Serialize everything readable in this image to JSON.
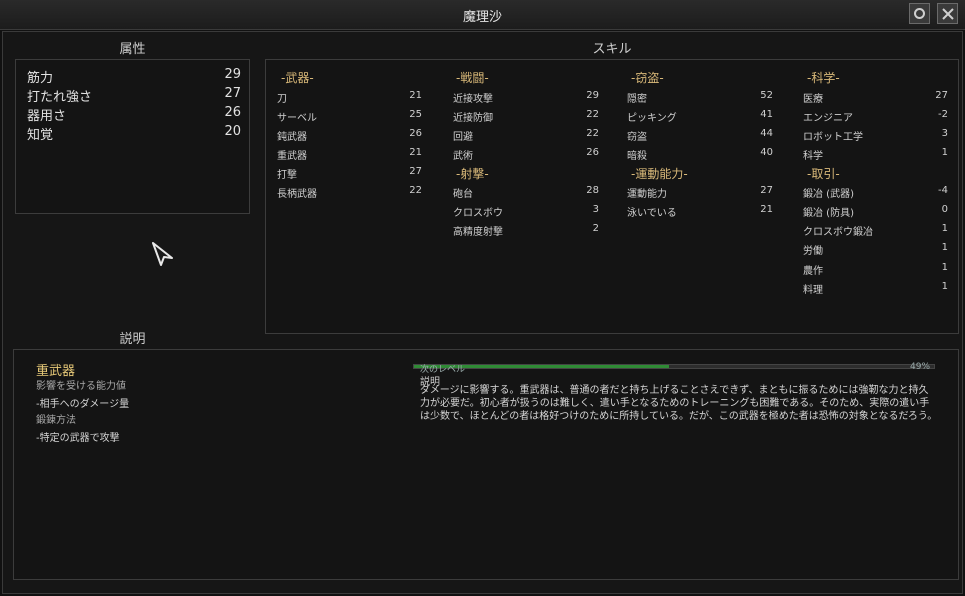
{
  "window": {
    "title": "魔理沙",
    "settings_icon": "gear-icon",
    "close_icon": "close-icon"
  },
  "attributes": {
    "header": "属性",
    "items": [
      {
        "name": "筋力",
        "value": "29"
      },
      {
        "name": "打たれ強さ",
        "value": "27"
      },
      {
        "name": "器用さ",
        "value": "26"
      },
      {
        "name": "知覚",
        "value": "20"
      }
    ]
  },
  "skills": {
    "header": "スキル",
    "categories": [
      {
        "name": "-武器-",
        "items": [
          {
            "name": "刀",
            "value": "21"
          },
          {
            "name": "サーベル",
            "value": "25"
          },
          {
            "name": "鈍武器",
            "value": "26"
          },
          {
            "name": "重武器",
            "value": "21"
          },
          {
            "name": "打撃",
            "value": "27"
          },
          {
            "name": "長柄武器",
            "value": "22"
          }
        ]
      },
      {
        "name": "-戦闘-",
        "items": [
          {
            "name": "近接攻撃",
            "value": "29"
          },
          {
            "name": "近接防御",
            "value": "22"
          },
          {
            "name": "回避",
            "value": "22"
          },
          {
            "name": "武術",
            "value": "26"
          }
        ]
      },
      {
        "name": "-射撃-",
        "items": [
          {
            "name": "砲台",
            "value": "28"
          },
          {
            "name": "クロスボウ",
            "value": "3"
          },
          {
            "name": "高精度射撃",
            "value": "2"
          }
        ]
      },
      {
        "name": "-窃盗-",
        "items": [
          {
            "name": "隠密",
            "value": "52"
          },
          {
            "name": "ピッキング",
            "value": "41"
          },
          {
            "name": "窃盗",
            "value": "44"
          },
          {
            "name": "暗殺",
            "value": "40"
          }
        ]
      },
      {
        "name": "-運動能力-",
        "items": [
          {
            "name": "運動能力",
            "value": "27"
          },
          {
            "name": "泳いでいる",
            "value": "21"
          }
        ]
      },
      {
        "name": "-科学-",
        "items": [
          {
            "name": "医療",
            "value": "27"
          },
          {
            "name": "エンジニア",
            "value": "-2"
          },
          {
            "name": "ロボット工学",
            "value": "3"
          },
          {
            "name": "科学",
            "value": "1"
          }
        ]
      },
      {
        "name": "-取引-",
        "items": [
          {
            "name": "鍛冶 (武器)",
            "value": "-4"
          },
          {
            "name": "鍛冶 (防具)",
            "value": "0"
          },
          {
            "name": "クロスボウ鍛冶",
            "value": "1"
          },
          {
            "name": "労働",
            "value": "1"
          },
          {
            "name": "農作",
            "value": "1"
          },
          {
            "name": "料理",
            "value": "1"
          }
        ]
      }
    ]
  },
  "description": {
    "header": "説明",
    "skill_name": "重武器",
    "affected_label": "影響を受ける能力値",
    "affected_value": "-相手へのダメージ量",
    "training_label": "鍛錬方法",
    "training_value": "-特定の武器で攻撃",
    "next_level_label": "次のレベル",
    "progress_text": "49%",
    "progress_fraction": 0.49,
    "text_label": "説明",
    "text": "ダメージに影響する。重武器は、普通の者だと持ち上げることさえできず、まともに振るためには強靭な力と持久力が必要だ。初心者が扱うのは難しく、遣い手となるためのトレーニングも困難である。そのため、実際の遣い手は少数で、ほとんどの者は格好つけのために所持している。だが、この武器を極めた者は恐怖の対象となるだろう。"
  },
  "colors": {
    "accent_gold": "#e7c978",
    "progress_green": "#2f8a35"
  }
}
